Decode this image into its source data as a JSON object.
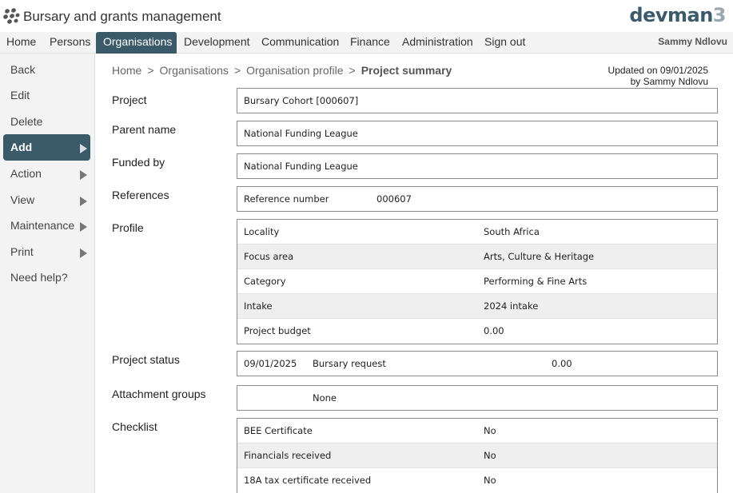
{
  "header": {
    "app_title": "Bursary and grants management",
    "brand": "devman",
    "brand_suffix": "3",
    "logo_icon": "paw-cluster-icon"
  },
  "topnav": {
    "items": [
      "Home",
      "Persons",
      "Organisations",
      "Development",
      "Communication",
      "Finance",
      "Administration",
      "Sign out"
    ],
    "active": "Organisations",
    "user": "Sammy Ndlovu"
  },
  "sidebar": {
    "items": [
      "Back",
      "Edit",
      "Delete",
      "Add",
      "Action",
      "View",
      "Maintenance",
      "Print",
      "Need help?"
    ],
    "active": "Add"
  },
  "breadcrumb": [
    "Home",
    "Organisations",
    "Organisation profile",
    "Project summary"
  ],
  "breadcrumb_sep": ">",
  "updated": {
    "line1": "Updated on 09/01/2025",
    "line2": "by Sammy Ndlovu"
  },
  "form": {
    "project_label": "Project",
    "project_value": "Bursary Cohort [000607]",
    "parent_label": "Parent name",
    "parent_value": "National Funding League",
    "funded_label": "Funded by",
    "funded_value": "National Funding League",
    "references_label": "References",
    "references": {
      "label": "Reference number",
      "value": "000607"
    },
    "profile_label": "Profile",
    "profile": [
      {
        "label": "Locality",
        "value": "South Africa"
      },
      {
        "label": "Focus area",
        "value": "Arts, Culture & Heritage"
      },
      {
        "label": "Category",
        "value": "Performing & Fine Arts"
      },
      {
        "label": "Intake",
        "value": "2024 intake"
      },
      {
        "label": "Project budget",
        "value": "0.00"
      }
    ],
    "status_label": "Project status",
    "status": {
      "date": "09/01/2025",
      "type": "Bursary request",
      "amount": "0.00"
    },
    "attachment_label": "Attachment groups",
    "attachment_value": "None",
    "checklist_label": "Checklist",
    "checklist": [
      {
        "label": "BEE Certificate",
        "value": "No"
      },
      {
        "label": "Financials received",
        "value": "No"
      },
      {
        "label": "18A tax certificate received",
        "value": "No"
      }
    ]
  },
  "colors": {
    "accent": "#3b5a69",
    "nav_bg": "#f3f3f3",
    "brand": "#3d5a6c"
  }
}
